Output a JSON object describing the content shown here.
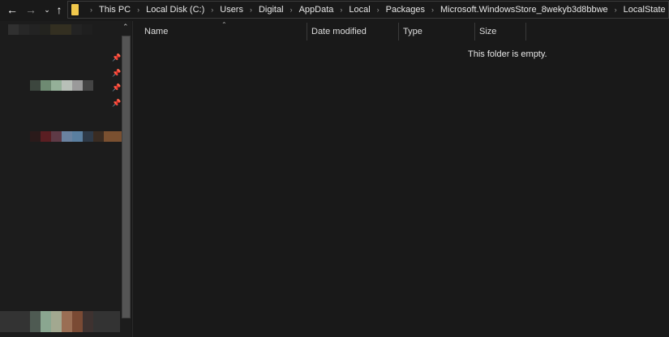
{
  "nav": {
    "back_icon": "arrow-left",
    "forward_icon": "arrow-right",
    "recent_icon": "chevron-down",
    "up_icon": "arrow-up"
  },
  "breadcrumb": [
    "This PC",
    "Local Disk (C:)",
    "Users",
    "Digital",
    "AppData",
    "Local",
    "Packages",
    "Microsoft.WindowsStore_8wekyb3d8bbwe",
    "LocalState"
  ],
  "columns": {
    "name": "Name",
    "date": "Date modified",
    "type": "Type",
    "size": "Size"
  },
  "content": {
    "empty_message": "This folder is empty."
  },
  "colors": {
    "background": "#191919",
    "folder": "#f2c94c"
  }
}
